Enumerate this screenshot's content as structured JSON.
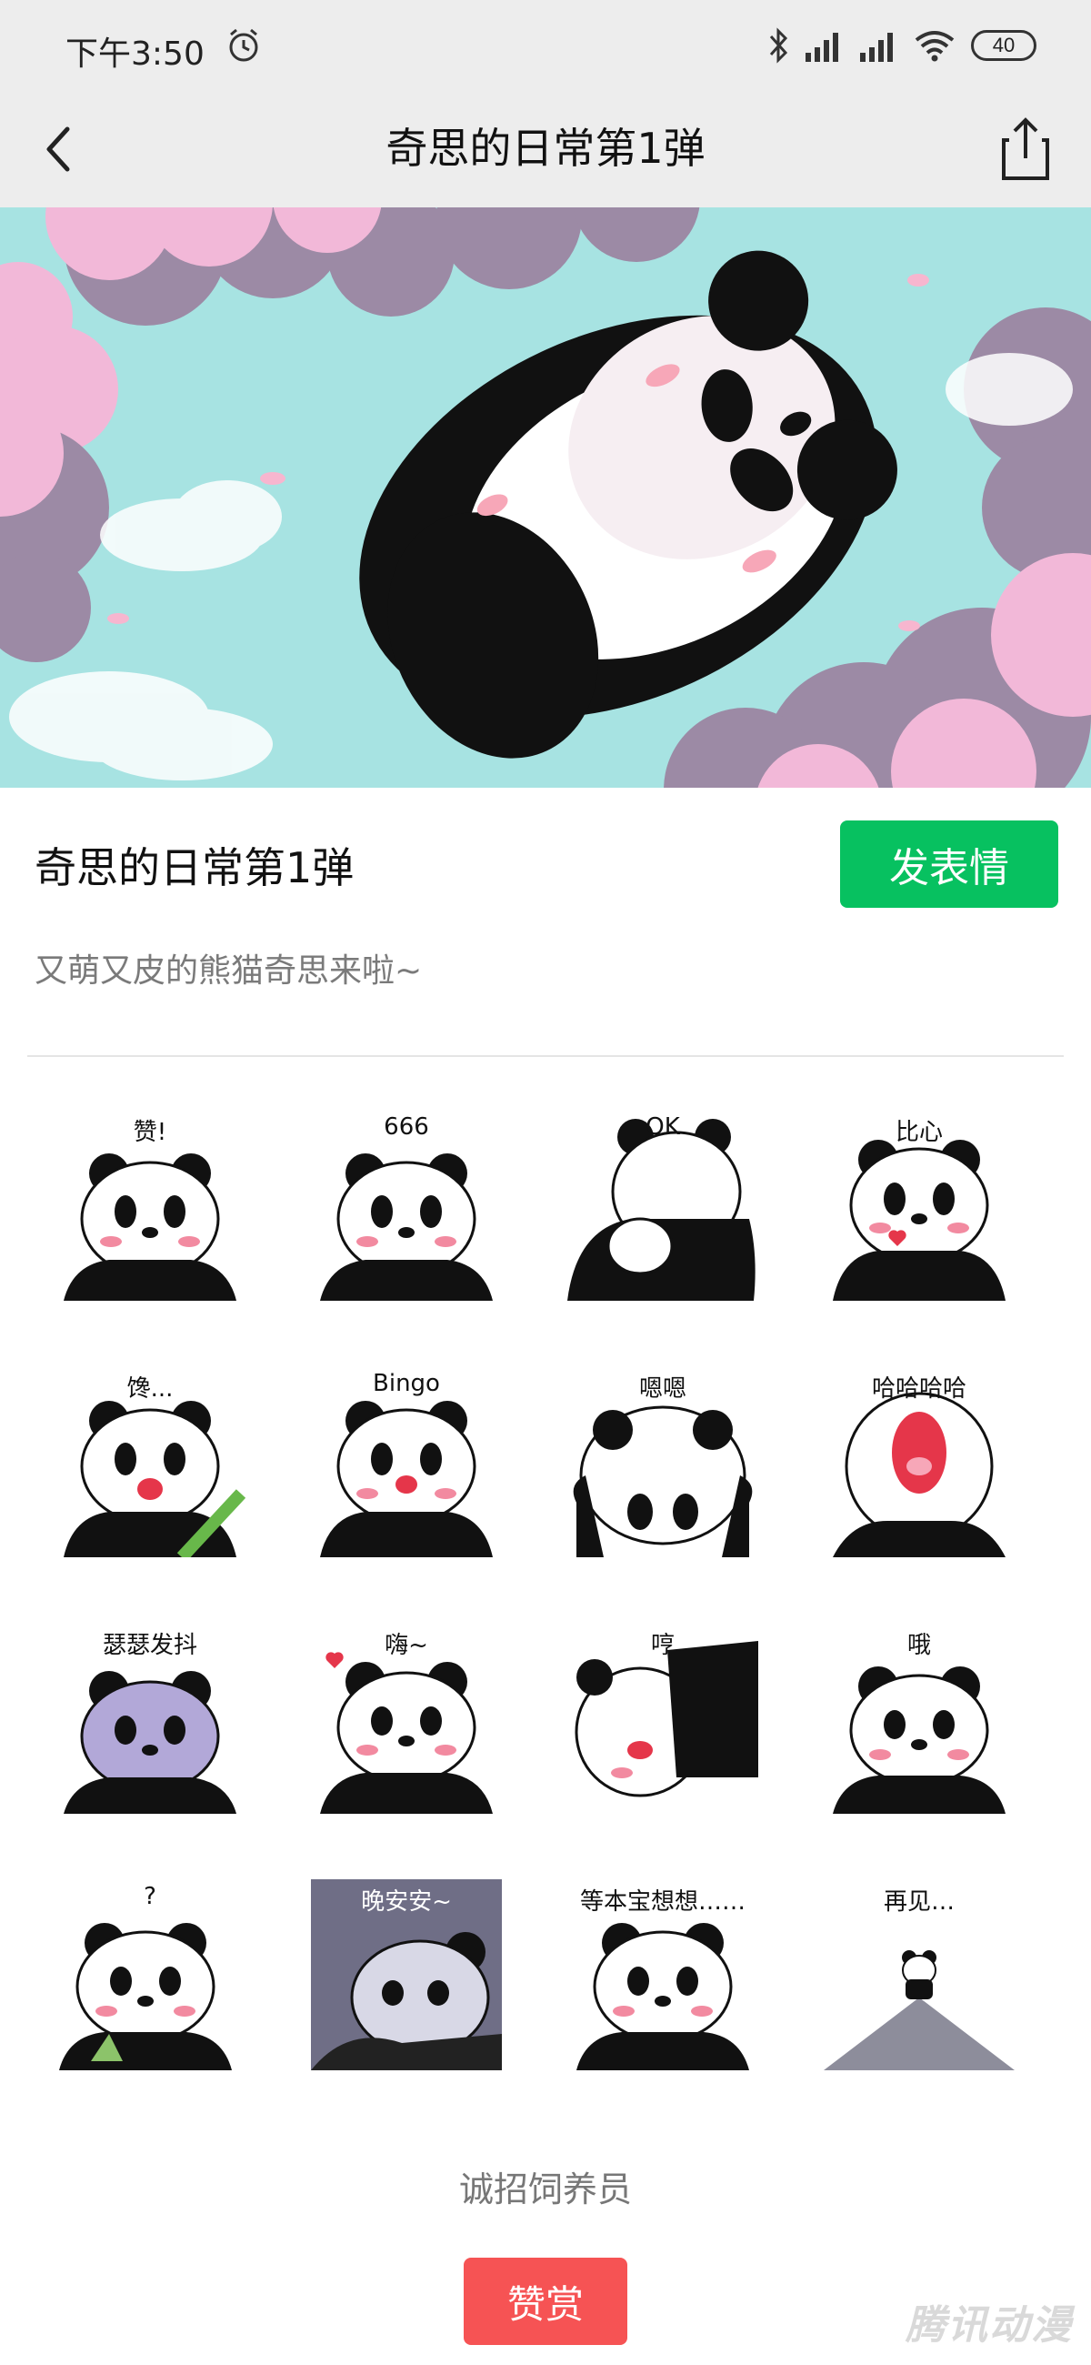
{
  "status_bar": {
    "time": "下午3:50",
    "battery": "40"
  },
  "nav": {
    "title": "奇思的日常第1弹"
  },
  "pack": {
    "title": "奇思的日常第1弹",
    "send_label": "发表情",
    "description": "又萌又皮的熊猫奇思来啦~"
  },
  "stickers": [
    {
      "caption": "赞!"
    },
    {
      "caption": "666"
    },
    {
      "caption": "OK"
    },
    {
      "caption": "比心"
    },
    {
      "caption": "馋..."
    },
    {
      "caption": "Bingo"
    },
    {
      "caption": "嗯嗯"
    },
    {
      "caption": "哈哈哈哈"
    },
    {
      "caption": "瑟瑟发抖"
    },
    {
      "caption": "嗨~"
    },
    {
      "caption": "哼"
    },
    {
      "caption": "哦"
    },
    {
      "caption": "?"
    },
    {
      "caption": "晚安安~"
    },
    {
      "caption": "等本宝想想……"
    },
    {
      "caption": "再见…"
    }
  ],
  "footer": {
    "recruit": "诚招饲养员",
    "tip_label": "赞赏",
    "watermark": "腾讯动漫"
  }
}
